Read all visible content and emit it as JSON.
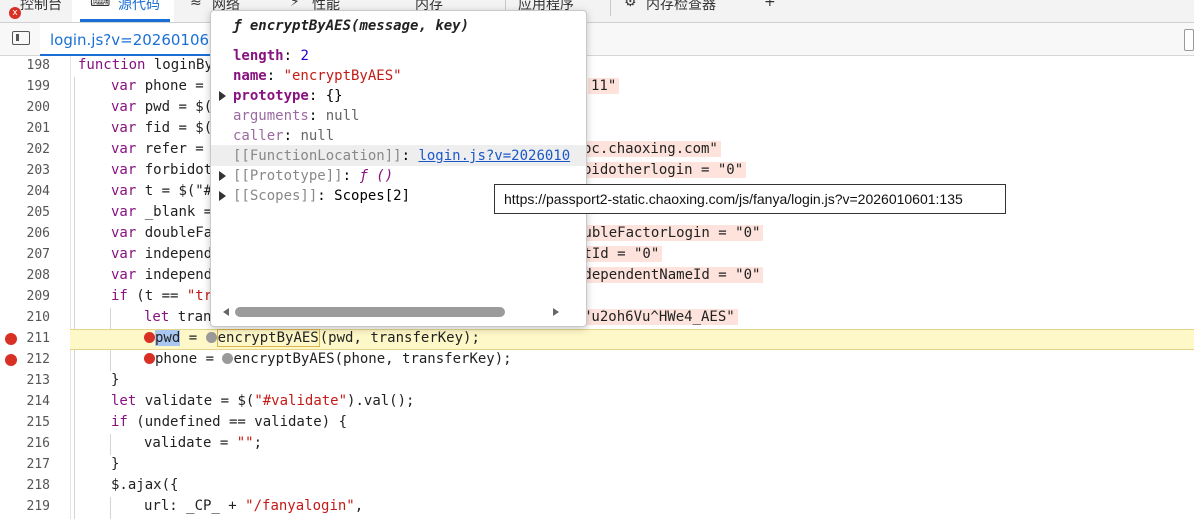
{
  "tabs": [
    {
      "label": "控制台"
    },
    {
      "label": "源代码"
    },
    {
      "label": "网络"
    },
    {
      "label": "性能"
    },
    {
      "label": "内存"
    },
    {
      "label": "应用程序"
    },
    {
      "label": "内存检查器"
    },
    {
      "label": "+"
    }
  ],
  "error_badge": "x",
  "file_tab": {
    "label": "login.js?v=2026010601"
  },
  "lines": [
    {
      "n": "198"
    },
    {
      "n": "199"
    },
    {
      "n": "200"
    },
    {
      "n": "201"
    },
    {
      "n": "202"
    },
    {
      "n": "203"
    },
    {
      "n": "204"
    },
    {
      "n": "205"
    },
    {
      "n": "206"
    },
    {
      "n": "207"
    },
    {
      "n": "208"
    },
    {
      "n": "209"
    },
    {
      "n": "210"
    },
    {
      "n": "211"
    },
    {
      "n": "212"
    },
    {
      "n": "213"
    },
    {
      "n": "214"
    },
    {
      "n": "215"
    },
    {
      "n": "216"
    },
    {
      "n": "217"
    },
    {
      "n": "218"
    },
    {
      "n": "219"
    }
  ],
  "code": {
    "l198": {
      "kw": "function",
      "rest": " loginBy"
    },
    "l199": {
      "kw": "var",
      "rest": " phone ="
    },
    "l200": {
      "kw": "var",
      "rest": " pwd = $("
    },
    "l201": {
      "kw": "var",
      "rest": " fid = $("
    },
    "l202": {
      "kw": "var",
      "rest": " refer ="
    },
    "l203": {
      "kw": "var",
      "rest": " forbidot"
    },
    "l204": {
      "kw": "var",
      "rest": " t = $(\"#"
    },
    "l205": {
      "kw": "var",
      "rest": " _blank ="
    },
    "l206": {
      "kw": "var",
      "rest": " doubleFa"
    },
    "l207": {
      "kw": "var",
      "rest": " independ"
    },
    "l208": {
      "kw": "var",
      "rest": " independ"
    },
    "l209": {
      "kw": "if",
      "rest": " (t == ",
      "str": "\"tr"
    },
    "l210": {
      "kw": "let",
      "rest": " tran"
    },
    "l211": {
      "sel": "pwd",
      "a": " = ",
      "fn": "encryptByAES",
      "b": "(pwd, transferKey);"
    },
    "l212": {
      "a": "phone = ",
      "b": "encryptByAES(phone, transferKey);"
    },
    "l213": {
      "rest": "}"
    },
    "l214": {
      "kw": "let",
      "rest": " validate = $(",
      "str": "\"#validate\"",
      "rest2": ").val();"
    },
    "l215": {
      "kw": "if",
      "rest": " (undefined == validate) {"
    },
    "l216": {
      "rest": "validate = ",
      "str": "\"\"",
      "rest2": ";"
    },
    "l217": {
      "rest": "}"
    },
    "l218": {
      "rest": "$.ajax({"
    },
    "l219": {
      "rest": "url: _CP_ + ",
      "str": "\"/fanyalogin\"",
      "rest2": ","
    }
  },
  "inline_values": {
    "v199": "11\"",
    "v202": "oc.chaoxing.com\"",
    "v203": "bidotherlogin = \"0\"",
    "v206": "oubleFactorLogin = \"0\"",
    "v207": "ntId = \"0\"",
    "v208": "ndependentNameId = \"0\"",
    "v210": "\"u2oh6Vu^HWe4_AES\""
  },
  "popover": {
    "f_symbol": "ƒ",
    "signature": "encryptByAES(message, key)",
    "props": {
      "length_name": "length",
      "length_value": "2",
      "name_name": "name",
      "name_value": "\"encryptByAES\"",
      "prototype_name": "prototype",
      "prototype_value": "{}",
      "arguments_name": "arguments",
      "arguments_value": "null",
      "caller_name": "caller",
      "caller_value": "null",
      "funcloc_name": "[[FunctionLocation]]",
      "funcloc_value": "login.js?v=2026010",
      "proto_name": "[[Prototype]]",
      "proto_value": "ƒ ()",
      "scopes_name": "[[Scopes]]",
      "scopes_value": "Scopes[2]"
    }
  },
  "tooltip": {
    "text": "https://passport2-static.chaoxing.com/js/fanya/login.js?v=2026010601:135"
  },
  "colors": {
    "accent": "#1a6fd6",
    "breakpoint": "#d93025",
    "paused_line": "#fef8c8",
    "keyword": "#881280",
    "string": "#c41a16"
  }
}
